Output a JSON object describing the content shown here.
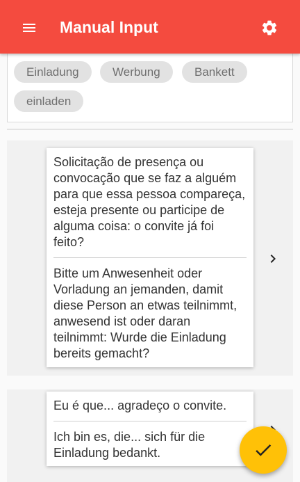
{
  "app_bar": {
    "title": "Manual Input",
    "menu_icon": "menu-icon",
    "settings_icon": "settings-gear-icon",
    "color": "#f44b3f"
  },
  "tags": [
    "Einladung",
    "Werbung",
    "Bankett",
    "einladen"
  ],
  "cards": [
    {
      "source": "Solicitação de presença ou convocação que se faz a alguém para que essa pessoa compareça, esteja presente ou participe de alguma coisa: o convite já foi feito?",
      "target": "Bitte um Anwesenheit oder Vorladung an jemanden, damit diese Person an etwas teilnimmt, anwesend ist oder daran teilnimmt: Wurde die Einladung bereits gemacht?"
    },
    {
      "source": "Eu é que... agradeço o convite.",
      "target": "Ich bin es, die... sich für die Einladung bedankt."
    }
  ],
  "fab": {
    "icon": "checkmark-icon",
    "color": "#ffc107"
  }
}
